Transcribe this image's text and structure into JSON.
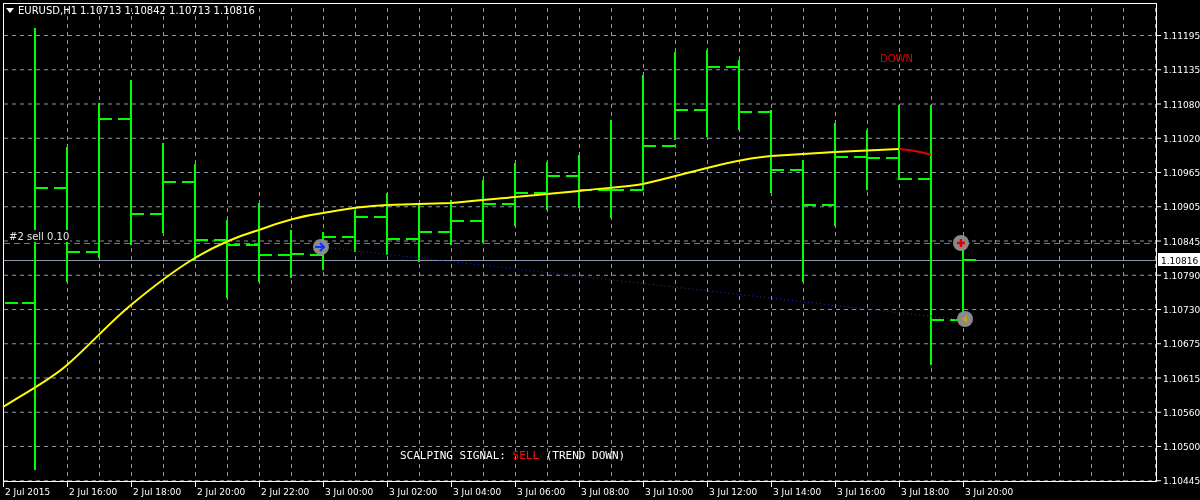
{
  "header": {
    "symbol": "EURUSD,H1",
    "quote": "1.10713 1.10842 1.10713 1.10816"
  },
  "trend_label": "DOWN",
  "order_line": {
    "label": "#2 sell 0.10"
  },
  "current_price": "1.10816",
  "price_axis": [
    "1.11195",
    "1.11135",
    "1.11080",
    "1.11020",
    "1.10965",
    "1.10905",
    "1.10845",
    "1.10790",
    "1.10730",
    "1.10675",
    "1.10615",
    "1.10560",
    "1.10500",
    "1.10445"
  ],
  "time_axis": [
    "2 Jul 2015",
    "2 Jul 16:00",
    "2 Jul 18:00",
    "2 Jul 20:00",
    "2 Jul 22:00",
    "3 Jul 00:00",
    "3 Jul 02:00",
    "3 Jul 04:00",
    "3 Jul 06:00",
    "3 Jul 08:00",
    "3 Jul 10:00",
    "3 Jul 12:00",
    "3 Jul 14:00",
    "3 Jul 16:00",
    "3 Jul 18:00",
    "3 Jul 20:00"
  ],
  "signal": {
    "label": "SCALPING SIGNAL:",
    "action": "SELL",
    "trend": "(TREND DOWN)"
  }
}
